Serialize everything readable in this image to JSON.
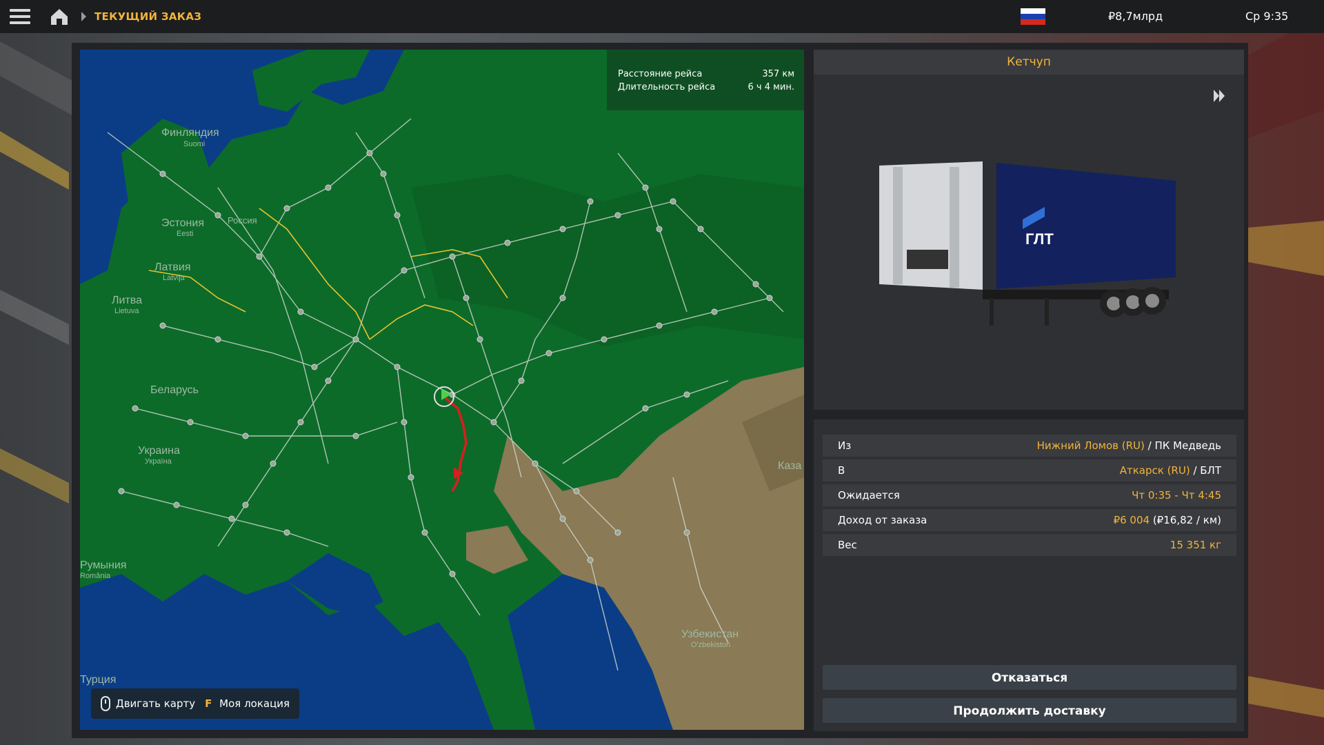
{
  "topbar": {
    "breadcrumb": "ТЕКУЩИЙ ЗАКАЗ",
    "money": "₽8,7млрд",
    "clock": "Ср 9:35",
    "flag_colors": [
      "#ffffff",
      "#1c3fb0",
      "#d52b1e"
    ]
  },
  "trip": {
    "distance_label": "Расстояние рейса",
    "distance_value": "357 км",
    "duration_label": "Длительность рейса",
    "duration_value": "6 ч 4 мин."
  },
  "map": {
    "labels": [
      {
        "name": "Финляндия",
        "sub": "Suomi"
      },
      {
        "name": "Эстония",
        "sub": "Eesti"
      },
      {
        "name": "Латвия",
        "sub": "Latvija"
      },
      {
        "name": "Литва",
        "sub": "Lietuva"
      },
      {
        "name": "Беларусь",
        "sub": ""
      },
      {
        "name": "Украина",
        "sub": "Україна"
      },
      {
        "name": "Румыния",
        "sub": "România"
      },
      {
        "name": "Турция",
        "sub": ""
      },
      {
        "name": "Узбекистан",
        "sub": "O'zbekiston"
      },
      {
        "name": "Каза",
        "sub": ""
      },
      {
        "name": "Россия",
        "sub": ""
      }
    ],
    "hint_move": "Двигать карту",
    "hint_key": "F",
    "hint_location": "Моя локация",
    "colors": {
      "land": "#0d6b2a",
      "water": "#0b3d86",
      "steppe": "#8a7a55",
      "route": "#d91e1e"
    }
  },
  "cargo": {
    "title": "Кетчуп",
    "trailer_brand": "ГЛТ"
  },
  "details": {
    "from_label": "Из",
    "from_city": "Нижний Ломов (RU)",
    "from_company": " / ПК Медведь",
    "to_label": "В",
    "to_city": "Аткарск (RU)",
    "to_company": " / БЛТ",
    "expected_label": "Ожидается",
    "expected_value": "Чт 0:35 - Чт 4:45",
    "income_label": "Доход от заказа",
    "income_value": "₽6 004",
    "income_rate": " (₽16,82 / км)",
    "weight_label": "Вес",
    "weight_value": "15 351 кг"
  },
  "buttons": {
    "refuse": "Отказаться",
    "continue": "Продолжить доставку"
  }
}
